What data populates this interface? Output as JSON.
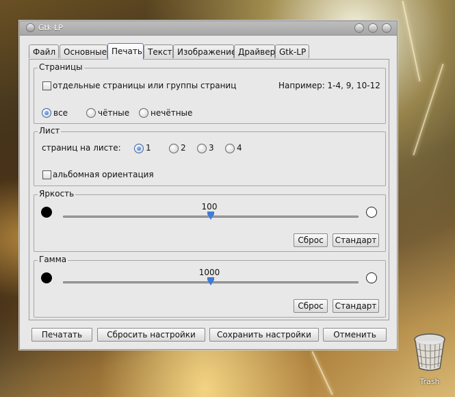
{
  "window": {
    "title": "Gtk-LP"
  },
  "tabs": [
    {
      "label": "Файл"
    },
    {
      "label": "Основные"
    },
    {
      "label": "Печать"
    },
    {
      "label": "Текст"
    },
    {
      "label": "Изображение"
    },
    {
      "label": "Драйвер"
    },
    {
      "label": "Gtk-LP"
    }
  ],
  "active_tab": "Печать",
  "pages_frame": {
    "title": "Страницы",
    "custom_pages_label": "отдельные страницы или группы страниц",
    "custom_pages_checked": false,
    "example_text": "Например: 1-4, 9, 10-12",
    "radios": [
      {
        "label": "все",
        "selected": true
      },
      {
        "label": "чётные",
        "selected": false
      },
      {
        "label": "нечётные",
        "selected": false
      }
    ]
  },
  "sheet_frame": {
    "title": "Лист",
    "pages_per_sheet_label": "страниц на листе:",
    "options": [
      {
        "label": "1",
        "selected": true
      },
      {
        "label": "2",
        "selected": false
      },
      {
        "label": "3",
        "selected": false
      },
      {
        "label": "4",
        "selected": false
      }
    ],
    "landscape_label": "альбомная ориентация",
    "landscape_checked": false
  },
  "brightness_frame": {
    "title": "Яркость",
    "value": "100",
    "slider_fraction": 0.5,
    "reset_label": "Сброс",
    "default_label": "Стандарт"
  },
  "gamma_frame": {
    "title": "Гамма",
    "value": "1000",
    "slider_fraction": 0.5,
    "reset_label": "Сброс",
    "default_label": "Стандарт"
  },
  "bottom_buttons": {
    "print": "Печатать",
    "reset_settings": "Сбросить настройки",
    "save_settings": "Сохранить настройки",
    "cancel": "Отменить"
  },
  "desktop": {
    "trash_label": "Trash"
  },
  "colors": {
    "accent": "#3f7bd8",
    "window_bg": "#e8e8e8"
  }
}
